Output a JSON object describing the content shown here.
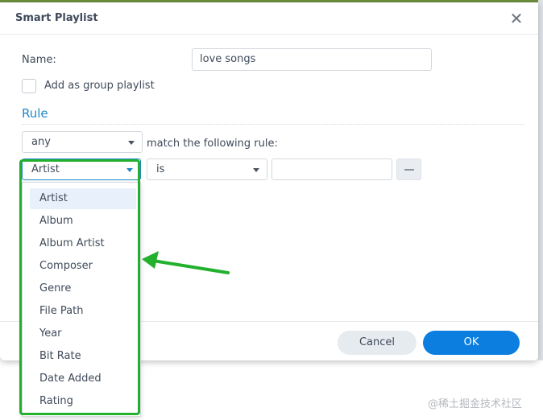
{
  "dialog": {
    "title": "Smart Playlist",
    "close_glyph": "✕"
  },
  "form": {
    "name_label": "Name:",
    "name_value": "love songs",
    "group_playlist_label": "Add as group playlist",
    "group_playlist_checked": false
  },
  "rule": {
    "heading": "Rule",
    "match_select": "any",
    "match_text": "match the following rule:",
    "field_select": "Artist",
    "operator_select": "is",
    "value": ""
  },
  "dropdown": {
    "items": [
      "Artist",
      "Album",
      "Album Artist",
      "Composer",
      "Genre",
      "File Path",
      "Year",
      "Bit Rate",
      "Date Added",
      "Rating"
    ],
    "selected": "Artist"
  },
  "footer": {
    "cancel_label": "Cancel",
    "ok_label": "OK"
  },
  "annotation": {
    "highlight_color": "#22b02d",
    "arrow_color": "#22b02d"
  },
  "watermark": "@稀土掘金技术社区",
  "colors": {
    "accent": "#1f88c9",
    "primary_button": "#0c7ee0"
  }
}
